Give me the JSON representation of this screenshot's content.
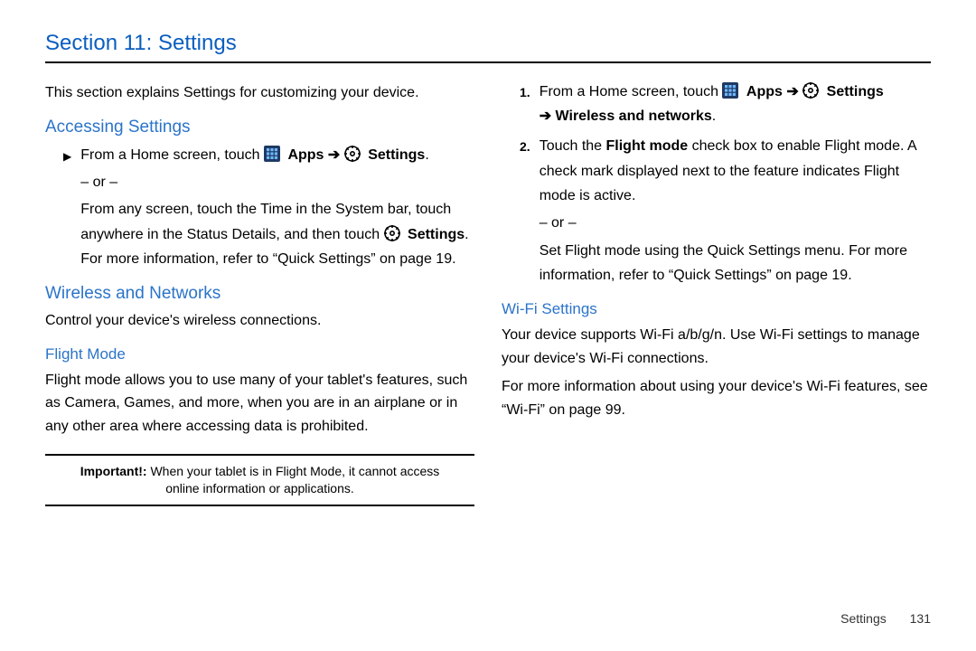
{
  "header": {
    "title": "Section 11: Settings"
  },
  "left": {
    "intro": "This section explains Settings for customizing your device.",
    "accessing_h": "Accessing Settings",
    "step1_a": "From a Home screen, touch ",
    "step1_apps": "Apps",
    "step1_settings": "Settings",
    "step1_period": ".",
    "or": "– or –",
    "step1_b_1": "From any screen, touch the Time in the System bar, touch anywhere in the Status Details, and then touch ",
    "step1_b_settings": "Settings",
    "step1_b_2": ". For more information, refer to ",
    "step1_b_xref": "“Quick Settings”",
    "step1_b_3": " on page 19.",
    "wireless_h": "Wireless and Networks",
    "wireless_p": "Control your device's wireless connections.",
    "flight_h": "Flight Mode",
    "flight_p": "Flight mode allows you to use many of your tablet's features, such as Camera, Games, and more, when you are in an airplane or in any other area where accessing data is prohibited.",
    "important_label": "Important!:",
    "important_text": " When your tablet is in Flight Mode, it cannot access online information or applications."
  },
  "right": {
    "r1_a": "From a Home screen, touch ",
    "r1_apps": "Apps",
    "r1_settings": "Settings",
    "r1_wn": "Wireless and networks",
    "r1_period": ".",
    "r2_a": "Touch the ",
    "r2_fm": "Flight mode",
    "r2_b": " check box to enable Flight mode. A check mark displayed next to the feature indicates Flight mode is active.",
    "or": "– or –",
    "r2_c_1": "Set Flight mode using the Quick Settings menu. For more information, refer to ",
    "r2_c_xref": "“Quick Settings”",
    "r2_c_2": "on page 19.",
    "wifi_h": "Wi-Fi Settings",
    "wifi_p1": "Your device supports Wi-Fi a/b/g/n. Use Wi-Fi settings to manage your device's Wi-Fi connections.",
    "wifi_p2_a": "For more information about using your device's Wi-Fi features, see ",
    "wifi_p2_xref": "“Wi-Fi”",
    "wifi_p2_b": " on page 99."
  },
  "footer": {
    "label": "Settings",
    "page": "131"
  }
}
